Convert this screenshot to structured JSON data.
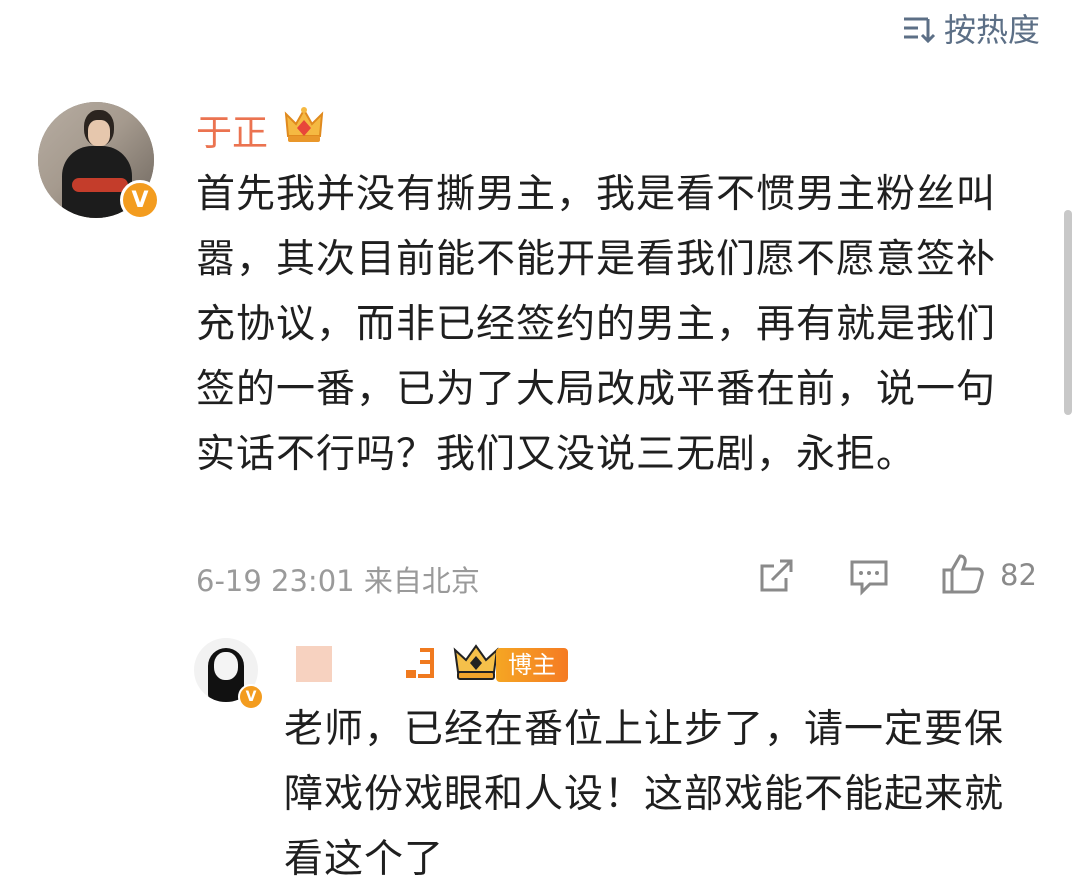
{
  "sort": {
    "label": "按热度"
  },
  "comment": {
    "username": "于正",
    "text": "首先我并没有撕男主，我是看不惯男主粉丝叫嚣，其次目前能不能开是看我们愿不愿意签补充协议，而非已经签约的男主，再有就是我们签的一番，已为了大局改成平番在前，说一句实话不行吗？我们又没说三无剧，永拒。",
    "time": "6-19 23:01",
    "location": "来自北京",
    "likes": "82",
    "verified_mark": "V"
  },
  "reply": {
    "badge_label": "博主",
    "text": "老师，已经在番位上让步了，请一定要保障戏份戏眼和人设！这部戏能不能起来就看这个了",
    "verified_mark": "V"
  },
  "colors": {
    "username": "#eb7350",
    "accent": "#f39c1f",
    "icon": "#5c6f86"
  }
}
